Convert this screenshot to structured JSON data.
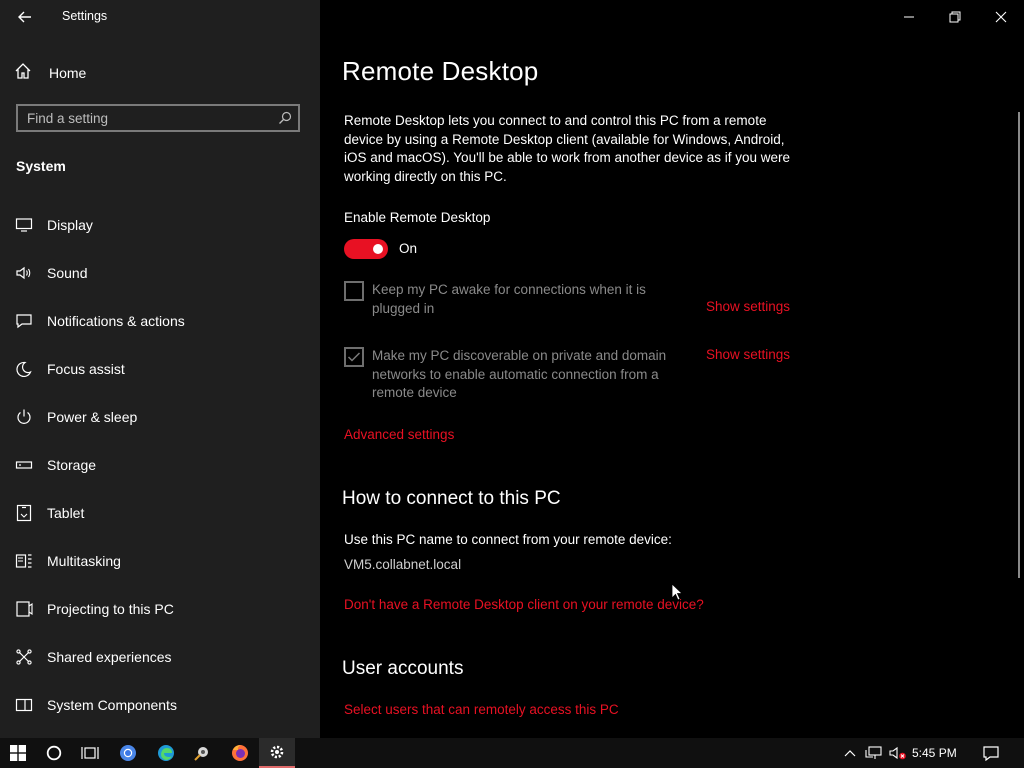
{
  "window": {
    "title": "Settings"
  },
  "sidebar": {
    "home_label": "Home",
    "search_placeholder": "Find a setting",
    "section_title": "System",
    "items": [
      {
        "label": "Display",
        "icon": "monitor-icon"
      },
      {
        "label": "Sound",
        "icon": "speaker-icon"
      },
      {
        "label": "Notifications & actions",
        "icon": "notification-icon"
      },
      {
        "label": "Focus assist",
        "icon": "moon-icon"
      },
      {
        "label": "Power & sleep",
        "icon": "power-icon"
      },
      {
        "label": "Storage",
        "icon": "storage-icon"
      },
      {
        "label": "Tablet",
        "icon": "tablet-icon"
      },
      {
        "label": "Multitasking",
        "icon": "multitasking-icon"
      },
      {
        "label": "Projecting to this PC",
        "icon": "projecting-icon"
      },
      {
        "label": "Shared experiences",
        "icon": "shared-experiences-icon"
      },
      {
        "label": "System Components",
        "icon": "system-components-icon"
      }
    ]
  },
  "main": {
    "title": "Remote Desktop",
    "description": "Remote Desktop lets you connect to and control this PC from a remote device by using a Remote Desktop client (available for Windows, Android, iOS and macOS). You'll be able to work from another device as if you were working directly on this PC.",
    "enable_label": "Enable Remote Desktop",
    "toggle_state": "On",
    "toggle_on": true,
    "options": [
      {
        "label": "Keep my PC awake for connections when it is plugged in",
        "checked": false,
        "link": "Show settings"
      },
      {
        "label": "Make my PC discoverable on private and domain networks to enable automatic connection from a remote device",
        "checked": true,
        "link": "Show settings"
      }
    ],
    "advanced_link": "Advanced settings",
    "connect_heading": "How to connect to this PC",
    "connect_text": "Use this PC name to connect from your remote device:",
    "pc_name": "VM5.collabnet.local",
    "client_link": "Don't have a Remote Desktop client on your remote device?",
    "accounts_heading": "User accounts",
    "accounts_link": "Select users that can remotely access this PC"
  },
  "taskbar": {
    "clock": "5:45 PM",
    "apps": [
      "windows-start-icon",
      "cortana-icon",
      "task-view-icon",
      "chrome-icon",
      "edge-icon",
      "app-icon",
      "firefox-icon",
      "settings-gear-icon"
    ]
  },
  "colors": {
    "accent": "#e81123",
    "sidebar_bg": "#1f1f1f",
    "main_bg": "#000000"
  }
}
